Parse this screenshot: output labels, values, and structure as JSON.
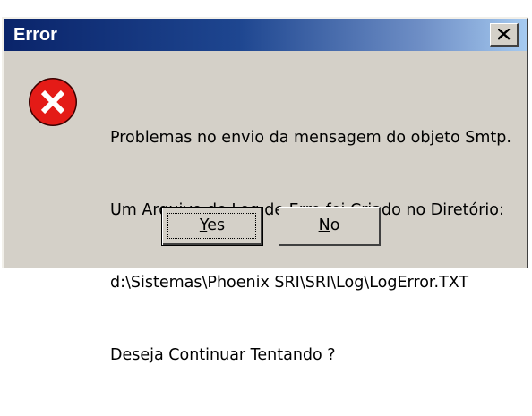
{
  "window": {
    "title": "Error",
    "close_glyph": "X"
  },
  "icon": {
    "name": "error-icon",
    "color": "#e41b17"
  },
  "message": {
    "lines": [
      "Problemas no envio da mensagem do objeto Smtp.",
      "Um Arquivo de Log de Erro foi Criado no Diretório:",
      "d:\\Sistemas\\Phoenix SRI\\SRI\\Log\\LogError.TXT",
      "Deseja Continuar Tentando ?"
    ]
  },
  "buttons": {
    "yes": {
      "accel": "Y",
      "rest": "es"
    },
    "no": {
      "accel": "N",
      "rest": "o"
    }
  }
}
